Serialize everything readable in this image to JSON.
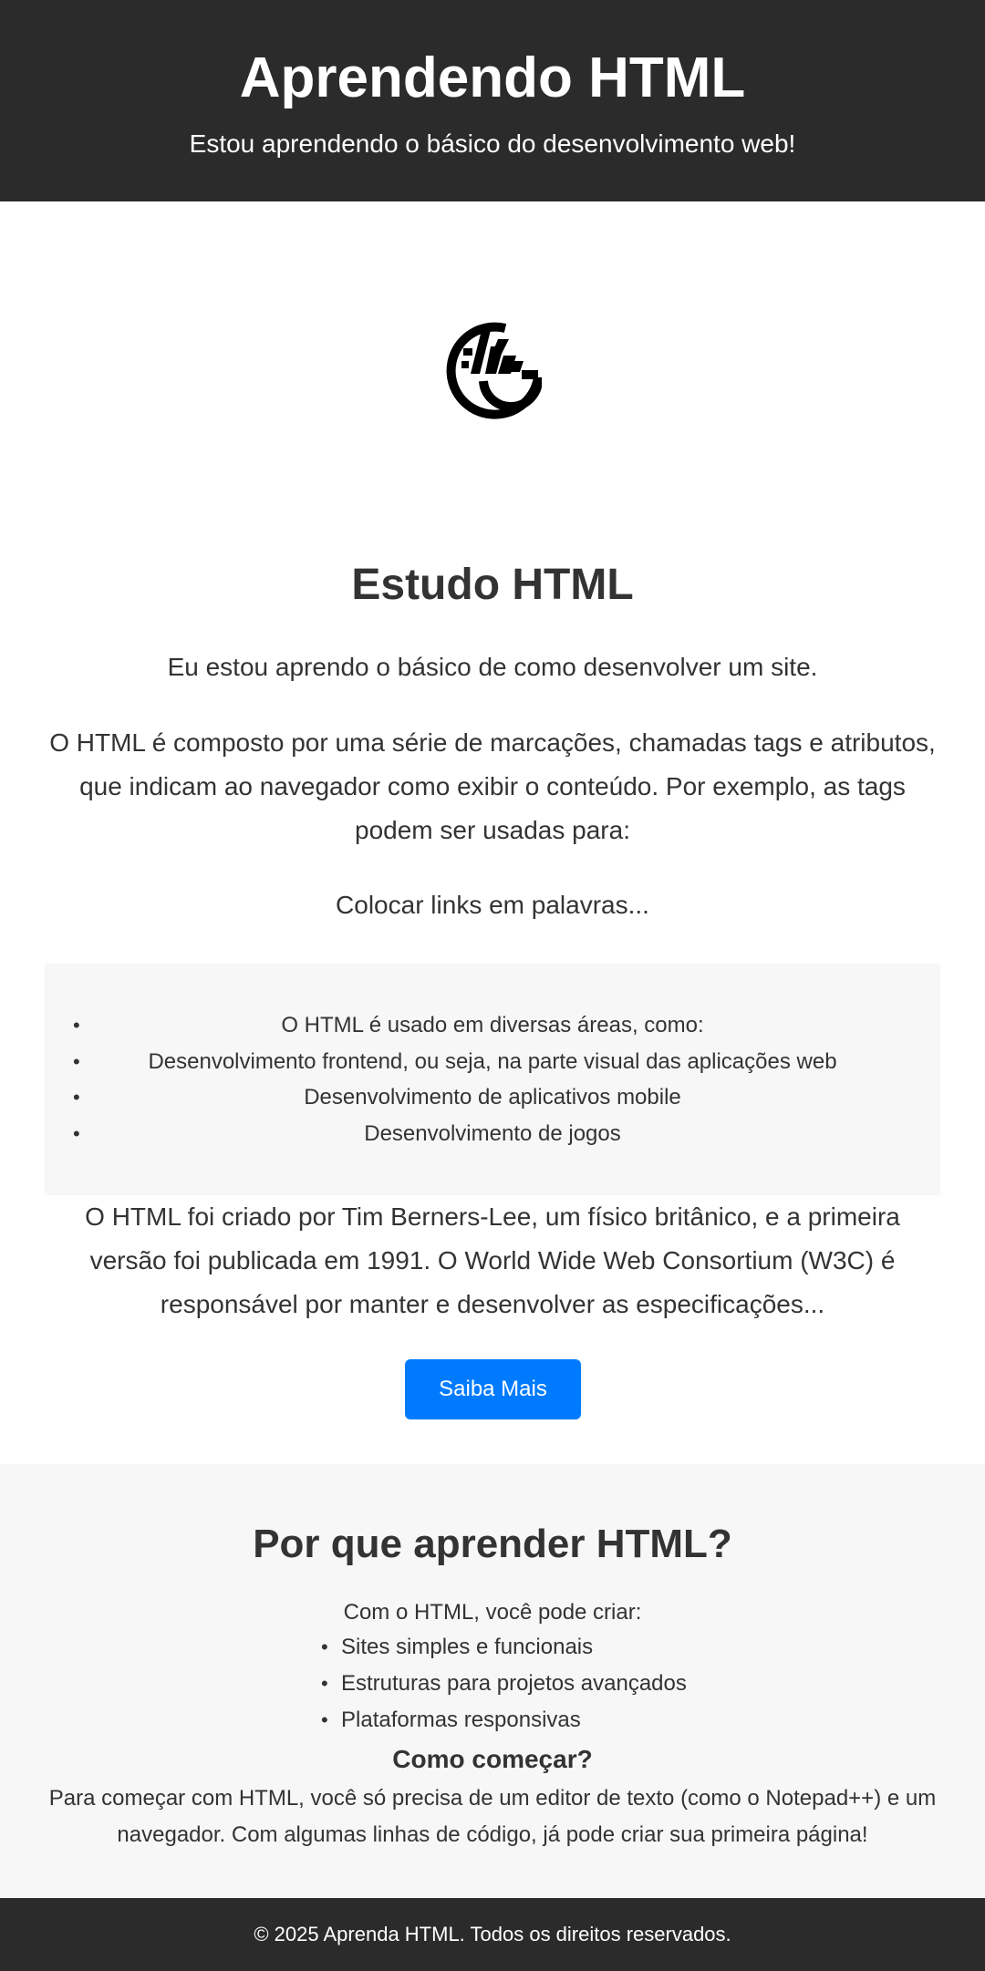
{
  "header": {
    "title": "Aprendendo HTML",
    "subtitle": "Estou aprendendo o básico do desenvolvimento web!"
  },
  "logo": {
    "icon": "html-study-logo-icon"
  },
  "main": {
    "title": "Estudo HTML",
    "intro": "Eu estou aprendo o básico de como desenvolver um site.",
    "description": "O HTML é composto por uma série de marcações, chamadas tags e atributos, que indicam ao navegador como exibir o conteúdo. Por exemplo, as tags podem ser usadas para:",
    "links_text": "Colocar links em palavras...",
    "uses": [
      "O HTML é usado em diversas áreas, como:",
      "Desenvolvimento frontend, ou seja, na parte visual das aplicações web",
      "Desenvolvimento de aplicativos mobile",
      "Desenvolvimento de jogos"
    ],
    "history": "O HTML foi criado por Tim Berners-Lee, um físico britânico, e a primeira versão foi publicada em 1991. O World Wide Web Consortium (W3C) é responsável por manter e desenvolver as especificações...",
    "button_label": "Saiba Mais"
  },
  "why": {
    "title": "Por que aprender HTML?",
    "lead": "Com o HTML, você pode criar:",
    "items": [
      "Sites simples e funcionais",
      "Estruturas para projetos avançados",
      "Plataformas responsivas"
    ],
    "start_title": "Como começar?",
    "start_text": "Para começar com HTML, você só precisa de um editor de texto (como o Notepad++) e um navegador. Com algumas linhas de código, já pode criar sua primeira página!"
  },
  "footer": {
    "text": "© 2025 Aprenda HTML. Todos os direitos reservados."
  },
  "colors": {
    "header_bg": "#2b2b2b",
    "button_bg": "#007bff",
    "section_bg": "#f7f7f7",
    "text": "#333333"
  }
}
